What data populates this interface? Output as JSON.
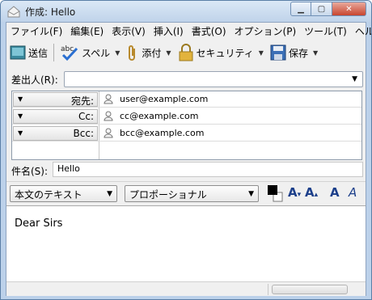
{
  "window": {
    "title": "作成: Hello"
  },
  "menu": [
    "ファイル(F)",
    "編集(E)",
    "表示(V)",
    "挿入(I)",
    "書式(O)",
    "オプション(P)",
    "ツール(T)",
    "ヘルプ(H)"
  ],
  "toolbar": {
    "send": "送信",
    "spell": "スペル",
    "attach": "添付",
    "security": "セキュリティ",
    "save": "保存"
  },
  "from": {
    "label": "差出人(R):",
    "value": ""
  },
  "recipients": [
    {
      "type": "宛先:",
      "address": "user@example.com"
    },
    {
      "type": "Cc:",
      "address": "cc@example.com"
    },
    {
      "type": "Bcc:",
      "address": "bcc@example.com"
    }
  ],
  "subject": {
    "label": "件名(S):",
    "value": "Hello"
  },
  "format": {
    "paragraph": "本文のテキスト",
    "font": "プロポーショナル"
  },
  "body": {
    "text": "Dear Sirs"
  },
  "colors": {
    "accent": "#1c3f8a",
    "titlebar": "#bfd3ea"
  }
}
